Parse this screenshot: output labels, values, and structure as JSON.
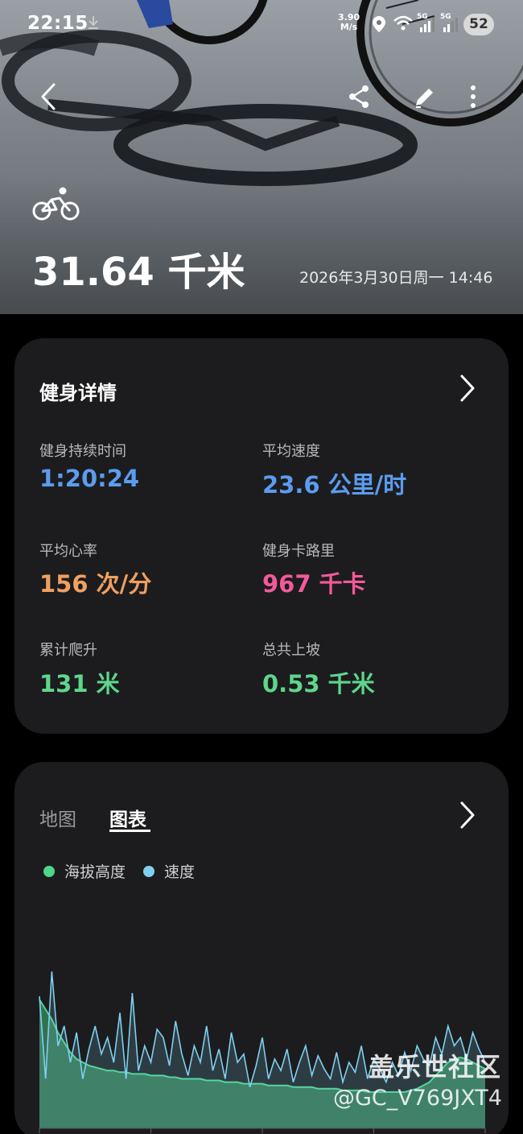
{
  "status_bar": {
    "time": "22:15",
    "net_speed_value": "3.90",
    "net_speed_unit": "M/s",
    "network_1": "5G",
    "network_2": "5G",
    "battery": "52",
    "icons": [
      "download-icon",
      "location-icon",
      "wifi-icon",
      "signal-icon",
      "signal-icon"
    ]
  },
  "hero": {
    "activity_icon": "cycling-icon",
    "distance": "31.64 千米",
    "datetime": "2026年3月30日周一 14:46",
    "actions": [
      "back-icon",
      "share-icon",
      "edit-icon",
      "more-icon"
    ]
  },
  "details": {
    "title": "健身详情",
    "stats": [
      {
        "label": "健身持续时间",
        "value": "1:20:24",
        "color": "#5b9cf0"
      },
      {
        "label": "平均速度",
        "value": "23.6 公里/时",
        "color": "#5b9cf0"
      },
      {
        "label": "平均心率",
        "value": "156 次/分",
        "color": "#f0a060"
      },
      {
        "label": "健身卡路里",
        "value": "967 千卡",
        "color": "#f25a9a"
      },
      {
        "label": "累计爬升",
        "value": "131 米",
        "color": "#5ed68c"
      },
      {
        "label": "总共上坡",
        "value": "0.53 千米",
        "color": "#5ed68c"
      }
    ]
  },
  "chart_card": {
    "tabs": [
      {
        "label": "地图",
        "active": false
      },
      {
        "label": "图表",
        "active": true
      }
    ],
    "legend": [
      {
        "label": "海拔高度",
        "color": "#4fd68a"
      },
      {
        "label": "速度",
        "color": "#7fd0f0"
      }
    ]
  },
  "chart_data": {
    "type": "area",
    "xlabel": "",
    "ylabel": "",
    "series": [
      {
        "name": "海拔高度",
        "color": "#4fd68a",
        "values": [
          0.78,
          0.72,
          0.66,
          0.58,
          0.52,
          0.46,
          0.42,
          0.4,
          0.38,
          0.37,
          0.36,
          0.35,
          0.35,
          0.34,
          0.34,
          0.33,
          0.33,
          0.33,
          0.32,
          0.32,
          0.32,
          0.31,
          0.31,
          0.3,
          0.3,
          0.3,
          0.3,
          0.29,
          0.29,
          0.29,
          0.28,
          0.28,
          0.28,
          0.27,
          0.27,
          0.27,
          0.27,
          0.26,
          0.26,
          0.26,
          0.26,
          0.25,
          0.25,
          0.25,
          0.25,
          0.24,
          0.24,
          0.24,
          0.24,
          0.23,
          0.23,
          0.23,
          0.23,
          0.22,
          0.22,
          0.22,
          0.22,
          0.22,
          0.22,
          0.22,
          0.23,
          0.24,
          0.26,
          0.28,
          0.32,
          0.36,
          0.4,
          0.42,
          0.43,
          0.42,
          0.4,
          0.38,
          0.36
        ]
      },
      {
        "name": "速度",
        "color": "#7fd0f0",
        "values": [
          0.8,
          0.3,
          0.95,
          0.5,
          0.62,
          0.4,
          0.58,
          0.3,
          0.48,
          0.62,
          0.45,
          0.55,
          0.4,
          0.7,
          0.3,
          0.82,
          0.35,
          0.5,
          0.4,
          0.6,
          0.55,
          0.38,
          0.65,
          0.45,
          0.32,
          0.5,
          0.4,
          0.62,
          0.35,
          0.48,
          0.3,
          0.58,
          0.4,
          0.45,
          0.25,
          0.38,
          0.55,
          0.3,
          0.42,
          0.35,
          0.48,
          0.28,
          0.4,
          0.5,
          0.32,
          0.44,
          0.36,
          0.3,
          0.46,
          0.28,
          0.4,
          0.34,
          0.5,
          0.3,
          0.42,
          0.36,
          0.28,
          0.4,
          0.32,
          0.46,
          0.35,
          0.5,
          0.42,
          0.38,
          0.55,
          0.45,
          0.62,
          0.5,
          0.55,
          0.42,
          0.58,
          0.48,
          0.4
        ]
      }
    ]
  },
  "watermark": {
    "line1": "盖乐世社区",
    "line2": "@GC_V769JXT4"
  }
}
